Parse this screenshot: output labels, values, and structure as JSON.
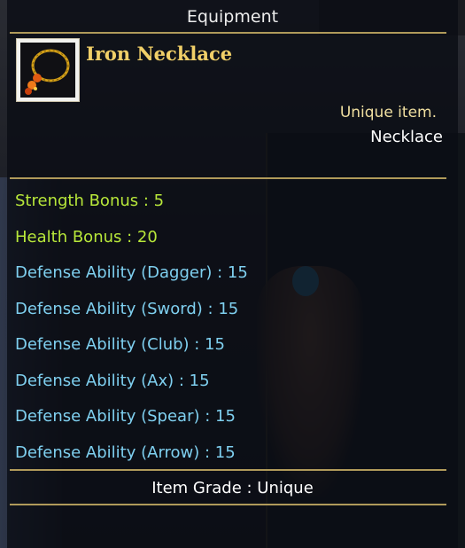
{
  "window": {
    "title": "Equipment"
  },
  "item": {
    "name": "Iron Necklace",
    "icon": "necklace-icon",
    "rarity_label": "Unique item.",
    "slot": "Necklace"
  },
  "stats": {
    "strength_bonus": "Strength Bonus : 5",
    "health_bonus": "Health Bonus : 20",
    "def_dagger": "Defense Ability (Dagger) : 15",
    "def_sword": "Defense Ability (Sword) : 15",
    "def_club": "Defense Ability (Club) : 15",
    "def_ax": "Defense Ability (Ax) : 15",
    "def_spear": "Defense Ability (Spear) : 15",
    "def_arrow": "Defense Ability (Arrow) : 15"
  },
  "grade": "Item Grade : Unique",
  "colors": {
    "item_name": "#f0cf68",
    "bonus_stat": "#b8e83a",
    "defense_stat": "#7fd0f0",
    "divider": "#b09a5a"
  }
}
